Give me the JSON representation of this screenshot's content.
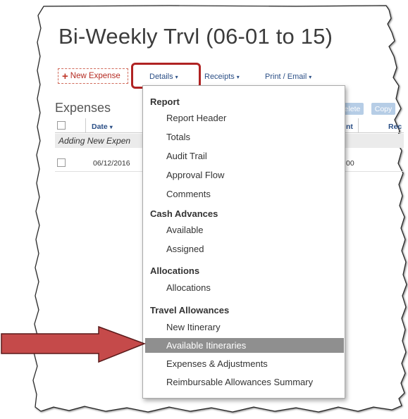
{
  "title": "Bi-Weekly Trvl (06-01 to 15)",
  "toolbar": {
    "new_expense": "New Expense",
    "plus": "+",
    "details": "Details",
    "receipts": "Receipts",
    "print_email": "Print / Email",
    "caret": "▾"
  },
  "expenses": {
    "title": "Expenses",
    "col_date": "Date",
    "col_amount_partial": "nt",
    "col_req_partial": "Rec",
    "delete_btn": "elete",
    "copy_btn": "Copy",
    "adding_row": "Adding New Expen",
    "rows": [
      {
        "date": "06/12/2016",
        "amount_partial": "00"
      }
    ]
  },
  "menu": {
    "sections": [
      {
        "label": "Report",
        "items": [
          "Report Header",
          "Totals",
          "Audit Trail",
          "Approval Flow",
          "Comments"
        ]
      },
      {
        "label": "Cash Advances",
        "items": [
          "Available",
          "Assigned"
        ]
      },
      {
        "label": "Allocations",
        "items": [
          "Allocations"
        ]
      },
      {
        "label": "Travel Allowances",
        "items": [
          "New Itinerary",
          "Available Itineraries",
          "Expenses & Adjustments",
          "Reimbursable Allowances Summary"
        ]
      }
    ],
    "selected_item": "Available Itineraries"
  },
  "colors": {
    "highlight_box": "#b02323",
    "arrow_fill": "#c54a4a",
    "selected_bg": "#8f8f8f",
    "link_blue": "#2b4f86"
  },
  "icons": {
    "pointer_arrow": "right-arrow-icon",
    "checkbox": "checkbox-icon"
  }
}
